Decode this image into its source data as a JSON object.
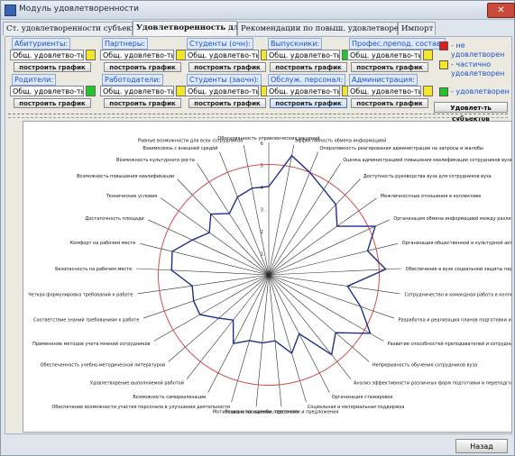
{
  "window": {
    "title": "Модуль удовлетворенности",
    "close_label": "✕"
  },
  "tabs": [
    {
      "label": "Ст. удовлетворенности субъектов",
      "active": false
    },
    {
      "label": "Удовлетворенность для ЛПР",
      "active": true
    },
    {
      "label": "Рекомендации по повыш. удовлетворенности",
      "active": false
    },
    {
      "label": "Импорт",
      "active": false
    }
  ],
  "groups": [
    {
      "label": "Абитуриенты:",
      "field": "Общ. удовлетво-ть:",
      "indicator": "yellow",
      "button": "построить график"
    },
    {
      "label": "Партнеры:",
      "field": "Общ. удовлетво-ть:",
      "indicator": "yellow",
      "button": "построить график"
    },
    {
      "label": "Студенты (очн):",
      "field": "Общ. удовлетво-ть:",
      "indicator": "yellow",
      "button": "построить график"
    },
    {
      "label": "Выпускники:",
      "field": "Общ. удовлетво-ть:",
      "indicator": "green",
      "button": "построить график"
    },
    {
      "label": "Профес.препод. состав:",
      "field": "Общ. удовлетво-ть:",
      "indicator": "yellow",
      "button": "построить график"
    },
    {
      "label": "Родители:",
      "field": "Общ. удовлетво-ть:",
      "indicator": "green",
      "button": "построить график"
    },
    {
      "label": "Работодатели:",
      "field": "Общ. удовлетво-ть:",
      "indicator": "yellow",
      "button": "построить график"
    },
    {
      "label": "Студенты (заочн):",
      "field": "Общ. удовлетво-ть:",
      "indicator": "yellow",
      "button": "построить график"
    },
    {
      "label": "Обслуж. персонал:",
      "field": "Общ. удовлетво-ть:",
      "indicator": "yellow",
      "button": "построить график"
    },
    {
      "label": "Администрация:",
      "field": "Общ. удовлетво-ть:",
      "indicator": "yellow",
      "button": "построить график"
    }
  ],
  "legend": [
    {
      "color": "#e01b1b",
      "lines": [
        "- не удовлетворен"
      ]
    },
    {
      "color": "#f1e62a",
      "lines": [
        "- частично",
        "удовлетворен"
      ]
    },
    {
      "color": "#22c42a",
      "lines": [
        "- удовлетворен"
      ]
    }
  ],
  "subjects_button": "Удовлет-ть субъектов",
  "back_button": "Назад",
  "colors": {
    "yellow": "#f1e62a",
    "green": "#22c42a",
    "red": "#e01b1b",
    "series": "#1f2f8a",
    "ref_circle": "#d0504f"
  },
  "chart_data": {
    "type": "radar",
    "rlim": [
      0,
      6
    ],
    "radial_ticks": [
      "1",
      "2",
      "3",
      "4",
      "5",
      "6"
    ],
    "reference_circle": 5,
    "categories": [
      "Обоснованность управленческих решений",
      "Эффективность обмена информацией",
      "Оперативность реагирования администрации на запросы и жалобы",
      "Оценка администрацией повышения квалификации сотрудников вуза",
      "Доступность руководства вуза для сотрудников вуза",
      "Межличностные отношения в коллективе",
      "Организация обмена информацией между различными",
      "Организация общественной и культурной активности",
      "Обеспечение в вузе социальной защиты персонала",
      "Сотрудничество и командная работа в коллективе",
      "Разработка и реализация планов подготовки и переп",
      "Развитие способностей преподавателей и сотрудников вуза",
      "Непрерывность обучения сотрудников вуза",
      "Анализ эффективности различных форм подготовки и переподготовки",
      "Организация стажировок",
      "Социальная и материальная поддержка",
      "Реакция на жалобы, претензии и предложения",
      "Мотивация и поощрение персонала",
      "Обеспечение возможности участия персонала в улучшении деятельности",
      "Возможность самореализации",
      "Удовлетворение выполняемой работой",
      "Обеспеченность учебно-методической литературой",
      "Применение методов учета мнений сотрудников",
      "Соответствие знаний требованиям к работе",
      "Четкая формулировка требований к работе",
      "Безопасность на рабочем месте",
      "Комфорт на рабочем месте",
      "Достаточность площади",
      "Технические условия",
      "Возможность повышения квалификации",
      "Возможность культурного роста",
      "Взаимосвязь с внешней средой",
      "Равные возможности для всех сотрудников"
    ],
    "values": [
      4.0,
      5.5,
      5.0,
      4.6,
      4.4,
      3.8,
      5.3,
      4.6,
      5.3,
      3.6,
      4.4,
      5.3,
      4.0,
      4.6,
      3.0,
      3.7,
      3.0,
      3.1,
      3.1,
      3.5,
      2.6,
      3.0,
      3.6,
      3.6,
      3.5,
      4.4,
      4.5,
      3.8,
      3.3,
      3.8,
      3.3,
      3.8,
      4.0
    ]
  }
}
